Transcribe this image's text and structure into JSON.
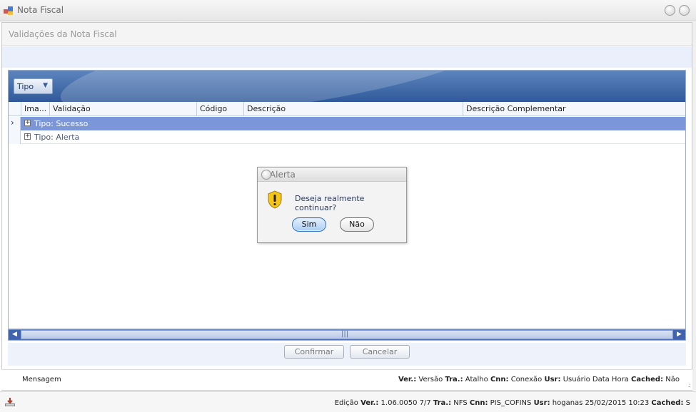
{
  "window": {
    "title": "Nota Fiscal",
    "icon": "app-form-icon"
  },
  "panel": {
    "title": "Validações da Nota Fiscal"
  },
  "grid": {
    "group_by_label": "Tipo",
    "columns": [
      "Ima...",
      "Validação",
      "Código",
      "Descrição",
      "Descrição Complementar"
    ],
    "rows": [
      {
        "label": "Tipo: Sucesso",
        "selected": true
      },
      {
        "label": "Tipo: Alerta",
        "selected": false
      }
    ]
  },
  "actions": {
    "confirm_label": "Confirmar",
    "cancel_label": "Cancelar"
  },
  "status_bar": {
    "message_label": "Mensagem",
    "ver_label": "Ver.:",
    "ver_value": "Versão",
    "tra_label": "Tra.:",
    "tra_value": "Atalho",
    "cnn_label": "Cnn:",
    "cnn_value": "Conexão",
    "usr_label": "Usr:",
    "usr_value": "Usuário Data Hora",
    "cached_label": "Cached:",
    "cached_value": "Não"
  },
  "footer": {
    "edition": "Edição",
    "ver_label": "Ver.:",
    "ver_value": "1.06.0050 7/7",
    "tra_label": "Tra.:",
    "tra_value": "NFS",
    "cnn_label": "Cnn:",
    "cnn_value": "PIS_COFINS",
    "usr_label": "Usr:",
    "usr_value": "hoganas 25/02/2015 10:23",
    "cached_label": "Cached:",
    "cached_value": "S"
  },
  "dialog": {
    "title": ":: Alerta",
    "message": "Deseja realmente continuar?",
    "yes_label": "Sim",
    "no_label": "Não",
    "icon": "warning-icon"
  },
  "colors": {
    "group_bar": "#2f5a99",
    "selected_row": "#7b97d9",
    "scrollbar": "#4c6fb6",
    "warning_yellow": "#f5c518"
  }
}
